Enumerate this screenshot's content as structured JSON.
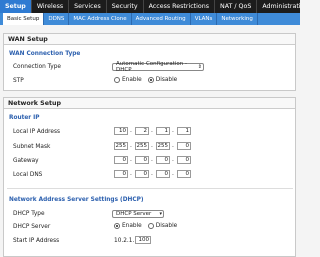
{
  "top_tabs": [
    "Setup",
    "Wireless",
    "Services",
    "Security",
    "Access Restrictions",
    "NAT / QoS",
    "Administration"
  ],
  "sub_tabs": [
    "Basic Setup",
    "DDNS",
    "MAC Address Clone",
    "Advanced Routing",
    "VLANs",
    "Networking"
  ],
  "wan": {
    "title": "WAN Setup",
    "connection_heading": "WAN Connection Type",
    "connection_type_label": "Connection Type",
    "connection_type_value": "Automatic Configuration - DHCP",
    "stp_label": "STP",
    "stp_enable": "Enable",
    "stp_disable": "Disable"
  },
  "network": {
    "title": "Network Setup",
    "router_ip_heading": "Router IP",
    "local_ip_label": "Local IP Address",
    "local_ip": [
      "10",
      "2",
      "1",
      "1"
    ],
    "subnet_label": "Subnet Mask",
    "subnet": [
      "255",
      "255",
      "255",
      "0"
    ],
    "gateway_label": "Gateway",
    "gateway": [
      "0",
      "0",
      "0",
      "0"
    ],
    "dns_label": "Local DNS",
    "dns": [
      "0",
      "0",
      "0",
      "0"
    ]
  },
  "dhcp": {
    "heading": "Network Address Server Settings (DHCP)",
    "type_label": "DHCP Type",
    "type_value": "DHCP Server",
    "server_label": "DHCP Server",
    "server_enable": "Enable",
    "server_disable": "Disable",
    "start_ip_label": "Start IP Address",
    "start_ip_prefix": "10.2.1.",
    "start_ip_value": "100"
  }
}
